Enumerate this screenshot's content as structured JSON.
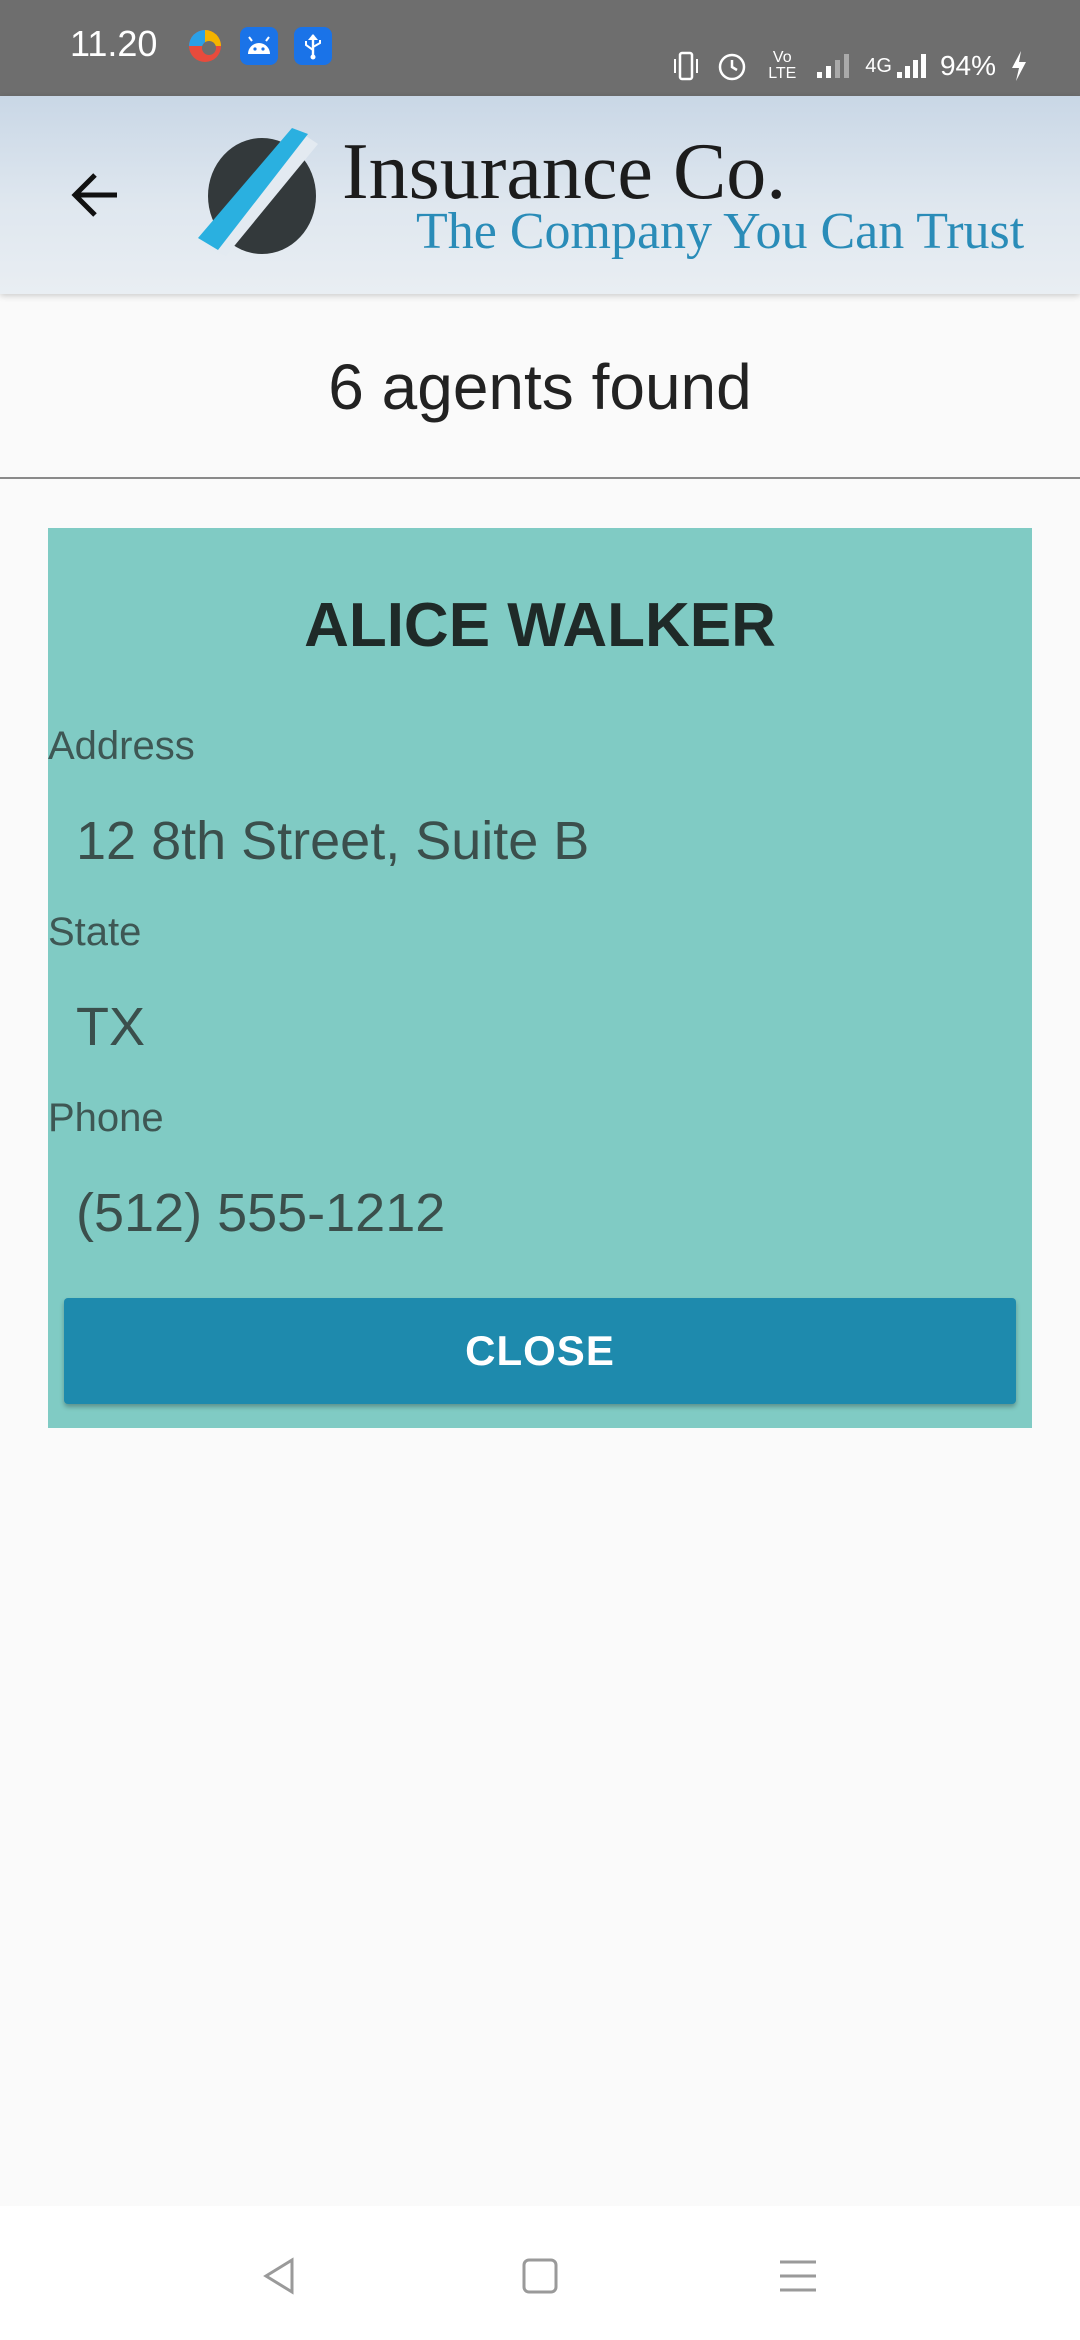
{
  "status_bar": {
    "time": "11.20",
    "battery": "94%",
    "network": "4G",
    "volte": "Vo LTE"
  },
  "header": {
    "brand_title": "Insurance Co.",
    "tagline": "The Company You Can Trust"
  },
  "results": {
    "summary": "6 agents found"
  },
  "agent": {
    "name": "ALICE WALKER",
    "address_label": "Address",
    "address": "12 8th Street, Suite B",
    "state_label": "State",
    "state": "TX",
    "phone_label": "Phone",
    "phone": "(512) 555-1212",
    "close_label": "CLOSE"
  },
  "colors": {
    "status_bar": "#6e6e6e",
    "card_background": "#80cbc4",
    "close_button": "#1e8aad",
    "tagline": "#2a8cb8"
  },
  "icons": {
    "back": "arrow-left-icon",
    "nav_back": "triangle-back-icon",
    "nav_home": "square-home-icon",
    "nav_menu": "menu-lines-icon"
  }
}
